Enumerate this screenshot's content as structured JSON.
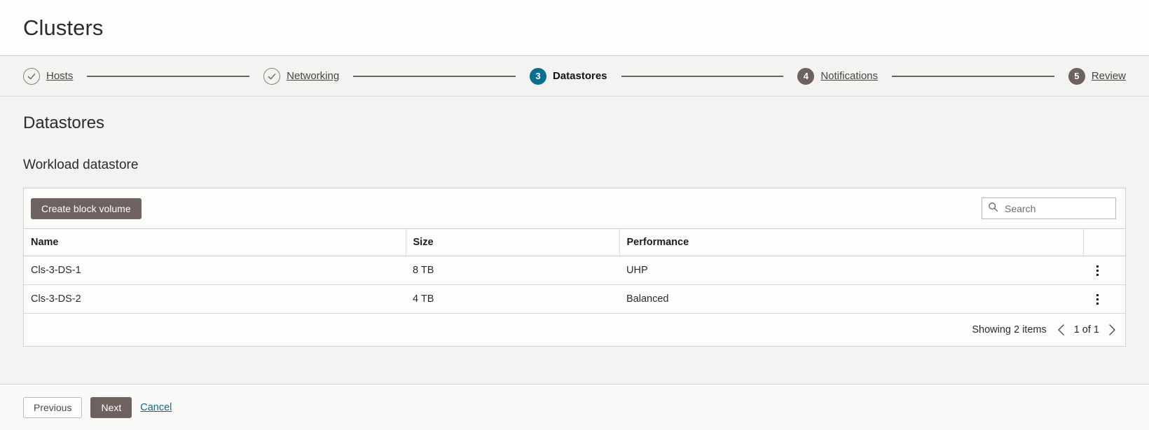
{
  "header": {
    "title": "Clusters"
  },
  "stepper": {
    "steps": [
      {
        "num": "1",
        "label": "Hosts",
        "state": "done"
      },
      {
        "num": "2",
        "label": "Networking",
        "state": "done"
      },
      {
        "num": "3",
        "label": "Datastores",
        "state": "current"
      },
      {
        "num": "4",
        "label": "Notifications",
        "state": "todo"
      },
      {
        "num": "5",
        "label": "Review",
        "state": "todo"
      }
    ]
  },
  "main": {
    "page_heading": "Datastores",
    "section_heading": "Workload datastore"
  },
  "toolbar": {
    "create_label": "Create block volume",
    "search_placeholder": "Search",
    "search_value": "",
    "search_icon": "search-icon"
  },
  "table": {
    "columns": [
      "Name",
      "Size",
      "Performance"
    ],
    "rows": [
      {
        "name": "Cls-3-DS-1",
        "size": "8 TB",
        "performance": "UHP"
      },
      {
        "name": "Cls-3-DS-2",
        "size": "4 TB",
        "performance": "Balanced"
      }
    ],
    "row_menu_icon": "kebab-menu-icon"
  },
  "footer": {
    "showing_text": "Showing 2 items",
    "page_text": "1 of 1",
    "prev_page_icon": "chevron-left-icon",
    "next_page_icon": "chevron-right-icon"
  },
  "actions": {
    "previous_label": "Previous",
    "next_label": "Next",
    "cancel_label": "Cancel"
  },
  "colors": {
    "accent_teal": "#0b6e8f",
    "brand_brown": "#6d625d",
    "link_teal": "#0f6c8c",
    "page_bg": "#f3f3f2",
    "card_bg": "#fdfdfc"
  }
}
